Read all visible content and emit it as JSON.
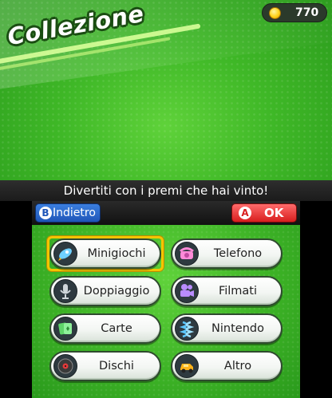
{
  "top": {
    "title": "Collezione",
    "coins": "770",
    "message": "Divertiti con i premi che hai vinto!"
  },
  "header": {
    "back_glyph": "B",
    "back_label": "Indietro",
    "ok_glyph": "A",
    "ok_label": "OK"
  },
  "menu": {
    "items": [
      {
        "label": "Minigiochi",
        "icon": "rocket-icon"
      },
      {
        "label": "Telefono",
        "icon": "telephone-icon"
      },
      {
        "label": "Doppiaggio",
        "icon": "microphone-icon"
      },
      {
        "label": "Filmati",
        "icon": "movie-camera-icon"
      },
      {
        "label": "Carte",
        "icon": "cards-icon"
      },
      {
        "label": "Nintendo",
        "icon": "nintendo-icon"
      },
      {
        "label": "Dischi",
        "icon": "disc-icon"
      },
      {
        "label": "Altro",
        "icon": "toy-car-icon"
      }
    ],
    "selected": "Minigiochi"
  },
  "colors": {
    "accent_green": "#3fb827",
    "back_blue": "#1f56b8",
    "ok_red": "#d81e1e",
    "selection_yellow": "#f5c400"
  }
}
